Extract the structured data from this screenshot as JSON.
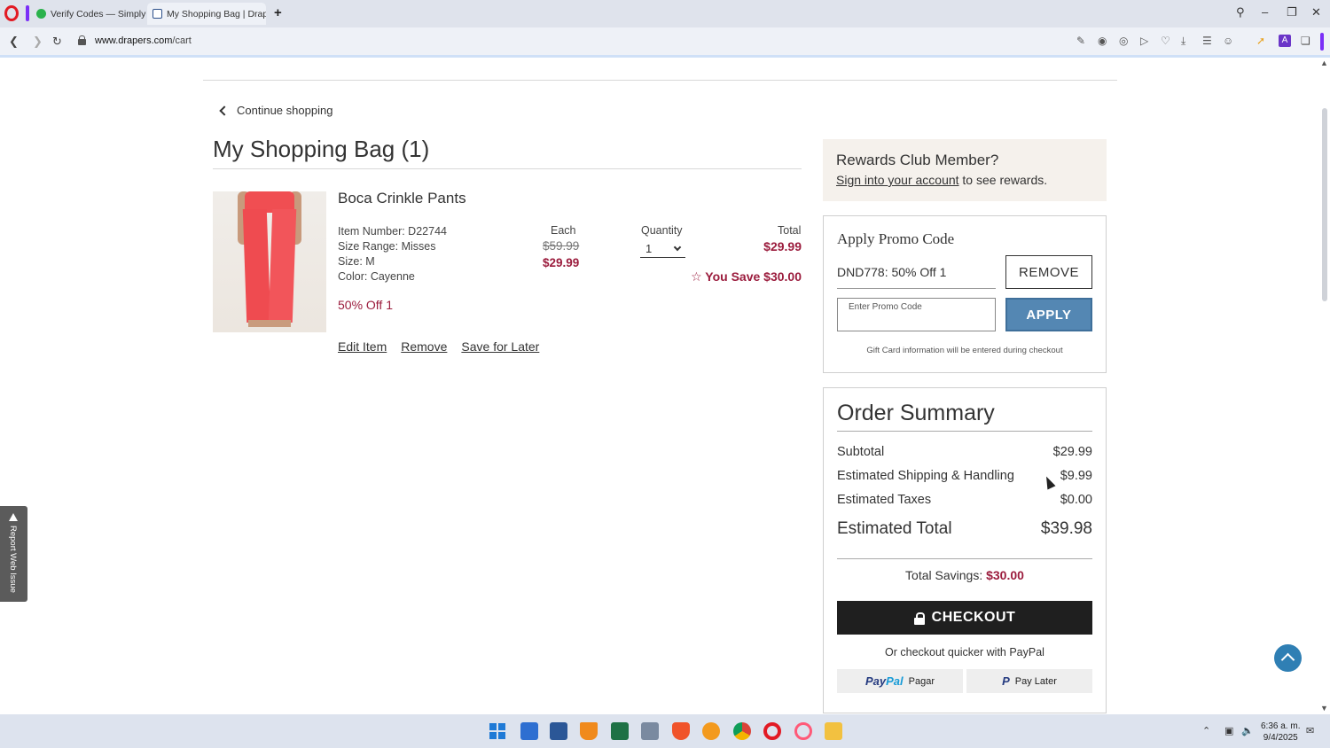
{
  "browser": {
    "tabs": [
      {
        "title": "Verify Codes — SimplyCo",
        "active": false
      },
      {
        "title": "My Shopping Bag | Drape",
        "active": true
      }
    ],
    "url_host": "www.drapers.com",
    "url_path": "/cart"
  },
  "page": {
    "continue_label": "Continue shopping",
    "bag_title": "My Shopping Bag (1)"
  },
  "item": {
    "name": "Boca Crinkle Pants",
    "details": [
      "Item Number: D22744",
      "Size Range: Misses",
      "Size: M",
      "Color: Cayenne"
    ],
    "promo_tag": "50% Off 1",
    "each_label": "Each",
    "price_original": "$59.99",
    "price_sale": "$29.99",
    "quantity_label": "Quantity",
    "quantity_value": "1",
    "total_label": "Total",
    "total_value": "$29.99",
    "you_save": "You Save $30.00",
    "actions": [
      "Edit Item",
      "Remove",
      "Save for Later"
    ]
  },
  "rewards": {
    "title": "Rewards Club Member?",
    "link": "Sign into your account",
    "suffix": " to see rewards."
  },
  "promo": {
    "title": "Apply Promo Code",
    "applied_code": "DND778: 50% Off 1",
    "remove_label": "REMOVE",
    "input_placeholder": "Enter Promo Code",
    "apply_label": "APPLY",
    "gift_note": "Gift Card information will be entered during checkout"
  },
  "summary": {
    "title": "Order Summary",
    "rows": [
      {
        "label": "Subtotal",
        "value": "$29.99"
      },
      {
        "label": "Estimated Shipping & Handling",
        "value": "$9.99"
      },
      {
        "label": "Estimated Taxes",
        "value": "$0.00"
      },
      {
        "label": "Estimated Total",
        "value": "$39.98"
      }
    ],
    "savings_label": "Total Savings: ",
    "savings_value": "$30.00",
    "checkout_label": "CHECKOUT",
    "paypal_note": "Or checkout quicker with PayPal",
    "paypal_btn_text": "Pagar",
    "paylater_btn_text": "Pay Later"
  },
  "report_tab": "Report Web Issue",
  "taskbar": {
    "time": "6:36 a. m.",
    "date": "9/4/2025"
  },
  "colors": {
    "accent_sale": "#9b1c3d",
    "apply_button": "#5487b3",
    "checkout_button": "#1f1f1f"
  }
}
